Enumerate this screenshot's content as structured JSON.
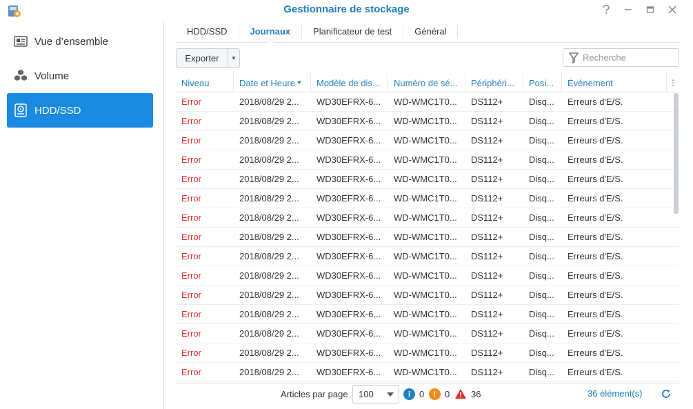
{
  "window": {
    "title": "Gestionnaire de stockage"
  },
  "sidebar": {
    "items": [
      {
        "label": "Vue d’ensemble",
        "icon": "overview-icon"
      },
      {
        "label": "Volume",
        "icon": "volume-icon"
      },
      {
        "label": "HDD/SSD",
        "icon": "hdd-icon",
        "active": true
      }
    ]
  },
  "tabs": [
    {
      "label": "HDD/SSD"
    },
    {
      "label": "Journaux",
      "active": true
    },
    {
      "label": "Planificateur de test"
    },
    {
      "label": "Général"
    }
  ],
  "toolbar": {
    "export_label": "Exporter",
    "search_placeholder": "Recherche"
  },
  "table": {
    "columns": [
      "Niveau",
      "Date et Heure",
      "Modèle de dis...",
      "Numéro de sé...",
      "Périphéri...",
      "Posi...",
      "Événement"
    ],
    "sorted_column": "Date et Heure",
    "rows": [
      [
        "Error",
        "2018/08/29 2...",
        "WD30EFRX-6...",
        "WD-WMC1T0...",
        "DS112+",
        "Disq...",
        "Erreurs d'E/S."
      ],
      [
        "Error",
        "2018/08/29 2...",
        "WD30EFRX-6...",
        "WD-WMC1T0...",
        "DS112+",
        "Disq...",
        "Erreurs d'E/S."
      ],
      [
        "Error",
        "2018/08/29 2...",
        "WD30EFRX-6...",
        "WD-WMC1T0...",
        "DS112+",
        "Disq...",
        "Erreurs d'E/S."
      ],
      [
        "Error",
        "2018/08/29 2...",
        "WD30EFRX-6...",
        "WD-WMC1T0...",
        "DS112+",
        "Disq...",
        "Erreurs d'E/S."
      ],
      [
        "Error",
        "2018/08/29 2...",
        "WD30EFRX-6...",
        "WD-WMC1T0...",
        "DS112+",
        "Disq...",
        "Erreurs d'E/S."
      ],
      [
        "Error",
        "2018/08/29 2...",
        "WD30EFRX-6...",
        "WD-WMC1T0...",
        "DS112+",
        "Disq...",
        "Erreurs d'E/S."
      ],
      [
        "Error",
        "2018/08/29 2...",
        "WD30EFRX-6...",
        "WD-WMC1T0...",
        "DS112+",
        "Disq...",
        "Erreurs d'E/S."
      ],
      [
        "Error",
        "2018/08/29 2...",
        "WD30EFRX-6...",
        "WD-WMC1T0...",
        "DS112+",
        "Disq...",
        "Erreurs d'E/S."
      ],
      [
        "Error",
        "2018/08/29 2...",
        "WD30EFRX-6...",
        "WD-WMC1T0...",
        "DS112+",
        "Disq...",
        "Erreurs d'E/S."
      ],
      [
        "Error",
        "2018/08/29 2...",
        "WD30EFRX-6...",
        "WD-WMC1T0...",
        "DS112+",
        "Disq...",
        "Erreurs d'E/S."
      ],
      [
        "Error",
        "2018/08/29 2...",
        "WD30EFRX-6...",
        "WD-WMC1T0...",
        "DS112+",
        "Disq...",
        "Erreurs d'E/S."
      ],
      [
        "Error",
        "2018/08/29 2...",
        "WD30EFRX-6...",
        "WD-WMC1T0...",
        "DS112+",
        "Disq...",
        "Erreurs d'E/S."
      ],
      [
        "Error",
        "2018/08/29 2...",
        "WD30EFRX-6...",
        "WD-WMC1T0...",
        "DS112+",
        "Disq...",
        "Erreurs d'E/S."
      ],
      [
        "Error",
        "2018/08/29 2...",
        "WD30EFRX-6...",
        "WD-WMC1T0...",
        "DS112+",
        "Disq...",
        "Erreurs d'E/S."
      ],
      [
        "Error",
        "2018/08/29 2...",
        "WD30EFRX-6...",
        "WD-WMC1T0...",
        "DS112+",
        "Disq...",
        "Erreurs d'E/S."
      ]
    ]
  },
  "footer": {
    "per_page_label": "Articles par page",
    "per_page_value": "100",
    "info_count": "0",
    "warning_count": "0",
    "error_count": "36",
    "total_label": "36 élément(s)"
  },
  "colors": {
    "accent": "#1f7fc1",
    "active_nav": "#1a8ae0",
    "error": "#d9302b",
    "warning": "#f28b1d",
    "info": "#1f7fc1"
  }
}
